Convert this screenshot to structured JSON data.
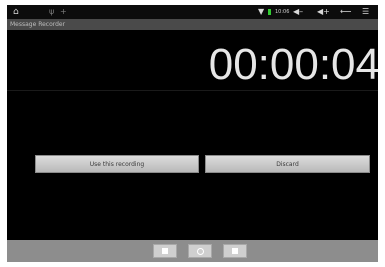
{
  "status_bar": {
    "icons": [
      "home-icon",
      "usb-icon",
      "plus-icon",
      "wifi-icon",
      "battery-icon",
      "volume-down-icon",
      "volume-up-icon",
      "back-icon",
      "menu-icon"
    ],
    "clock": "10:06"
  },
  "title_bar": {
    "title": "Message Recorder"
  },
  "timer": {
    "value": "00:00:04"
  },
  "buttons": {
    "use_label": "Use this recording",
    "discard_label": "Discard"
  },
  "nav_bar": {
    "icons": [
      "nav-dot-icon",
      "nav-circle-icon",
      "nav-square-icon"
    ]
  },
  "colors": {
    "background": "#000000",
    "title_bar": "#4a4a4a",
    "nav_bar": "#8d8d8d",
    "button": "#c9c9c9",
    "timer_text": "#e6e6e6"
  }
}
